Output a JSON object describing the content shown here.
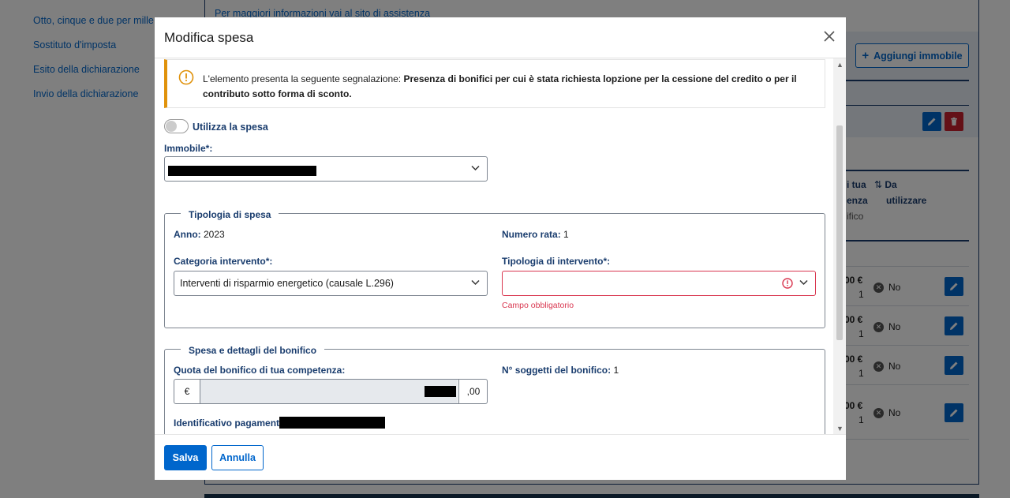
{
  "background": {
    "sidebar_items": [
      "Otto, cinque e due per mille",
      "Sostituto d'imposta",
      "Esito della dichiarazione",
      "Invio della dichiarazione"
    ],
    "info_link": "Per maggiori informazioni vai al sito di assistenza",
    "add_property_button": "Aggiungi immobile",
    "col_header_1": [
      "i tua",
      "enza",
      "ifico"
    ],
    "col_header_2": [
      "Da",
      "utilizzare"
    ],
    "rows": [
      {
        "amount": "00 €",
        "count": "1",
        "use": "No"
      },
      {
        "amount": "00 €",
        "count": "1",
        "use": "No"
      },
      {
        "amount": "00 €",
        "count": "1",
        "use": "No"
      },
      {
        "amount": "00 €",
        "count": "1",
        "use": "No"
      }
    ]
  },
  "modal": {
    "title": "Modifica spesa",
    "alert": {
      "prefix": "L'elemento presenta la seguente segnalazione: ",
      "message": "Presenza di bonifici per cui è stata richiesta lopzione per la cessione del credito o per il contributo sotto forma di sconto."
    },
    "toggle_label": "Utilizza la spesa",
    "property_label": "Immobile*:",
    "section_type": {
      "legend": "Tipologia di spesa",
      "year_label": "Anno:",
      "year_value": "2023",
      "installment_label": "Numero rata:",
      "installment_value": "1",
      "category_label": "Categoria intervento*:",
      "category_value": "Interventi di risparmio energetico (causale L.296)",
      "intervention_label": "Tipologia di intervento*:",
      "intervention_value": "",
      "required_error": "Campo obbligatorio"
    },
    "section_payment": {
      "legend": "Spesa e dettagli del bonifico",
      "share_label": "Quota del bonifico di tua competenza:",
      "currency_prefix": "€",
      "decimal_suffix": ",00",
      "subjects_label": "N° soggetti del bonifico:",
      "subjects_value": "1",
      "payment_id_label": "Identificativo pagamento:"
    },
    "save_button": "Salva",
    "cancel_button": "Annulla"
  },
  "colors": {
    "primary": "#0066cc",
    "warning": "#e0920b",
    "error": "#d9364f",
    "label": "#1a3d6e"
  }
}
